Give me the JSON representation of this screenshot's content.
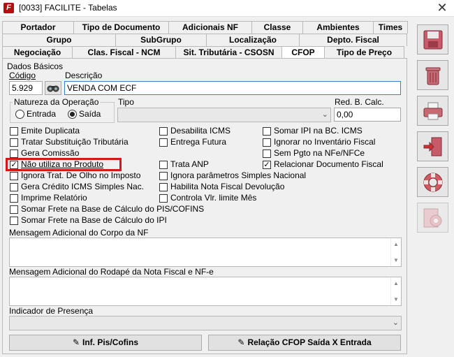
{
  "window": {
    "title": "[0033] FACILITE - Tabelas",
    "close_glyph": "✕"
  },
  "tabs": {
    "row1": [
      "Portador",
      "Tipo de Documento",
      "Adicionais NF",
      "Classe",
      "Ambientes",
      "Times"
    ],
    "row2": [
      "Grupo",
      "SubGrupo",
      "Localização",
      "Depto. Fiscal"
    ],
    "row3": [
      "Negociação",
      "Clas. Fiscal - NCM",
      "Sit. Tributária - CSOSN",
      "CFOP",
      "Tipo de Preço"
    ],
    "active": "CFOP"
  },
  "dados_basicos": {
    "legend": "Dados Básicos",
    "codigo_label": "Código",
    "codigo_value": "5.929",
    "descricao_label": "Descrição",
    "descricao_value": "VENDA COM ECF",
    "natureza_label": "Natureza da Operação",
    "entrada_label": "Entrada",
    "saida_label": "Saída",
    "natureza_selected": "Saída",
    "tipo_label": "Tipo",
    "tipo_value": "",
    "red_label": "Red. B. Calc.",
    "red_value": "0,00"
  },
  "checkboxes": {
    "emite_duplicata": {
      "label": "Emite Duplicata",
      "checked": false
    },
    "tratar_st": {
      "label": "Tratar Substituição Tributária",
      "checked": false
    },
    "gera_comissao": {
      "label": "Gera Comissão",
      "checked": false
    },
    "nao_utiliza": {
      "label": "Não utiliza no Produto",
      "checked": true
    },
    "ignora_trat": {
      "label": "Ignora Trat. De Olho no Imposto",
      "checked": false
    },
    "gera_credito": {
      "label": "Gera Crédito ICMS Simples Nac.",
      "checked": false
    },
    "imprime_relatorio": {
      "label": "Imprime Relatório",
      "checked": false
    },
    "somar_frete_pis": {
      "label": "Somar Frete na Base de Cálculo do PIS/COFINS",
      "checked": false
    },
    "somar_frete_ipi": {
      "label": "Somar Frete na Base de Cálculo do IPI",
      "checked": false
    },
    "desabilita_icms": {
      "label": "Desabilita ICMS",
      "checked": false
    },
    "entrega_futura": {
      "label": "Entrega Futura",
      "checked": false
    },
    "trata_anp": {
      "label": "Trata ANP",
      "checked": false
    },
    "ignora_parametros": {
      "label": "Ignora parâmetros Simples Nacional",
      "checked": false
    },
    "habilita_devolucao": {
      "label": "Habilita Nota Fiscal Devolução",
      "checked": false
    },
    "controla_limite": {
      "label": "Controla Vlr. limite Mês",
      "checked": false
    },
    "somar_ipi": {
      "label": "Somar IPI na BC. ICMS",
      "checked": false
    },
    "ignorar_inventario": {
      "label": "Ignorar no Inventário Fiscal",
      "checked": false
    },
    "sem_pgto": {
      "label": "Sem Pgto na NFe/NFCe",
      "checked": false
    },
    "relacionar_doc": {
      "label": "Relacionar Documento Fiscal",
      "checked": true
    }
  },
  "mensagens": {
    "corpo_label": "Mensagem Adicional do Corpo da NF",
    "rodape_label": "Mensagem Adicional do Rodapé da Nota Fiscal e NF-e",
    "indicador_label": "Indicador de Presença",
    "indicador_value": ""
  },
  "buttons": {
    "inf_pis": "Inf. Pis/Cofins",
    "relacao_cfop": "Relação CFOP Saída X Entrada"
  },
  "side_toolbar": [
    "save-icon",
    "trash-icon",
    "printer-icon",
    "exit-door-icon",
    "lifebuoy-icon",
    "settings-gears-icon"
  ],
  "colors": {
    "highlight_box": "#d8141c",
    "focus_border": "#3a7fcf"
  }
}
